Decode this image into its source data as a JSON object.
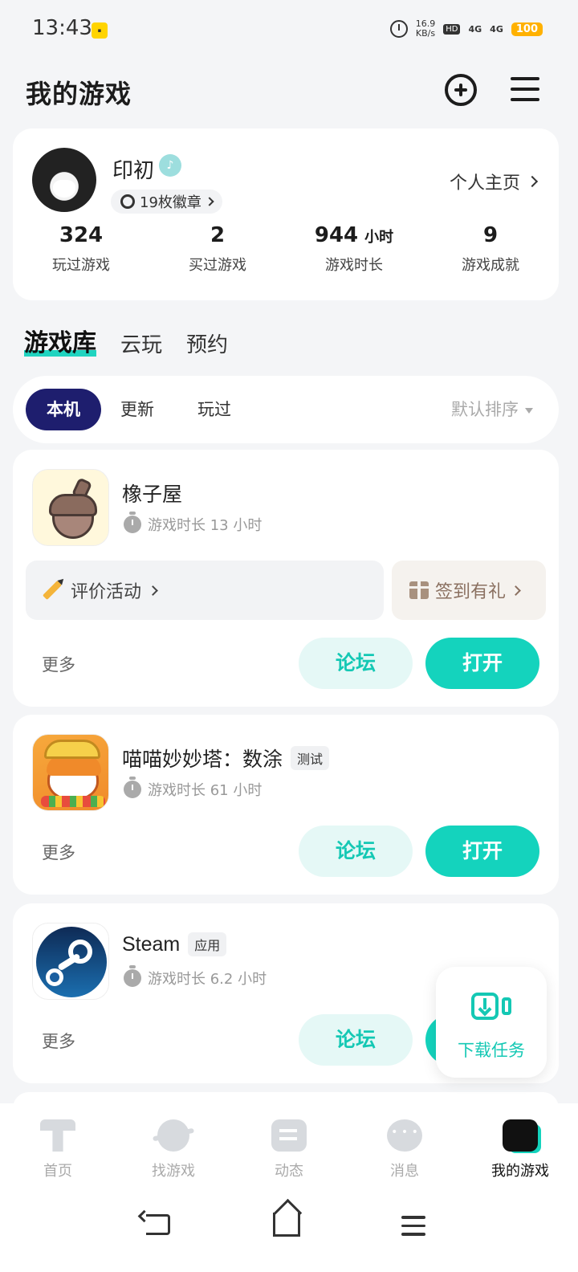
{
  "status_bar": {
    "time": "13:43",
    "net_speed_value": "16.9",
    "net_speed_unit": "KB/s",
    "hd": "HD",
    "network_1": "4G",
    "network_2": "4G",
    "battery": "100"
  },
  "header": {
    "title": "我的游戏"
  },
  "profile": {
    "name": "印初",
    "badges": "19枚徽章",
    "homepage_link": "个人主页",
    "stats": [
      {
        "value": "324",
        "unit": "",
        "label": "玩过游戏"
      },
      {
        "value": "2",
        "unit": "",
        "label": "买过游戏"
      },
      {
        "value": "944",
        "unit": "小时",
        "label": "游戏时长"
      },
      {
        "value": "9",
        "unit": "",
        "label": "游戏成就"
      }
    ]
  },
  "section_tabs": [
    {
      "label": "游戏库",
      "active": true
    },
    {
      "label": "云玩",
      "active": false
    },
    {
      "label": "预约",
      "active": false
    }
  ],
  "filters": {
    "chips": [
      {
        "label": "本机",
        "active": true
      },
      {
        "label": "更新",
        "active": false
      },
      {
        "label": "玩过",
        "active": false
      }
    ],
    "sort": "默认排序"
  },
  "games": [
    {
      "name": "橡子屋",
      "tag": "",
      "playtime": "游戏时长 13 小时",
      "review_label": "评价活动",
      "signin_label": "签到有礼",
      "more": "更多",
      "forum": "论坛",
      "open": "打开"
    },
    {
      "name": "喵喵妙妙塔：数涂",
      "tag": "测试",
      "playtime": "游戏时长 61 小时",
      "more": "更多",
      "forum": "论坛",
      "open": "打开"
    },
    {
      "name": "Steam",
      "tag": "应用",
      "playtime": "游戏时长 6.2 小时",
      "more": "更多",
      "forum": "论坛",
      "open": "打开"
    }
  ],
  "download": {
    "label": "下载任务"
  },
  "bottom_nav": [
    {
      "label": "首页",
      "icon": "home-icon"
    },
    {
      "label": "找游戏",
      "icon": "planet-icon"
    },
    {
      "label": "动态",
      "icon": "feed-icon"
    },
    {
      "label": "消息",
      "icon": "message-icon"
    },
    {
      "label": "我的游戏",
      "icon": "gamepad-icon",
      "active": true
    }
  ],
  "colors": {
    "accent": "#14d3bd",
    "chip_active": "#1e1e6e",
    "forum_bg": "#e5f8f6"
  }
}
